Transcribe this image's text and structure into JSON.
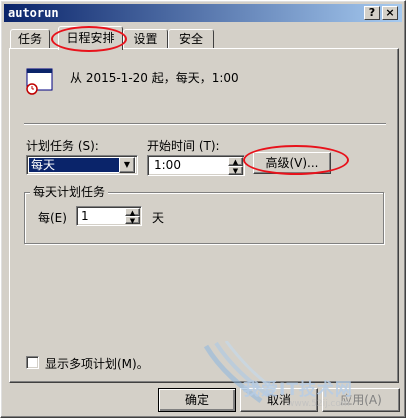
{
  "window": {
    "title": "autorun",
    "help_label": "?",
    "close_label": "×"
  },
  "tabs": [
    {
      "label": "任务"
    },
    {
      "label": "日程安排"
    },
    {
      "label": "设置"
    },
    {
      "label": "安全"
    }
  ],
  "schedule": {
    "summary": "从 2015-1-20 起，每天，1:00",
    "task_label": "计划任务 (S):",
    "task_value": "每天",
    "start_time_label": "开始时间 (T):",
    "start_time_value": "1:00",
    "advanced_label": "高级(V)..."
  },
  "daily": {
    "group_label": "每天计划任务",
    "every_label": "每(E)",
    "every_value": "1",
    "unit_label": "天"
  },
  "options": {
    "show_multiple_label": "显示多项计划(M)。"
  },
  "footer": {
    "ok_label": "确定",
    "cancel_label": "取消",
    "apply_label": "应用(A)"
  },
  "watermark": {
    "text": "我爱IT技术网",
    "url": "www.52ij.com"
  },
  "colors": {
    "annotation": "#e8121b",
    "selection": "#0a246a",
    "titlebar": "#0a246a"
  }
}
